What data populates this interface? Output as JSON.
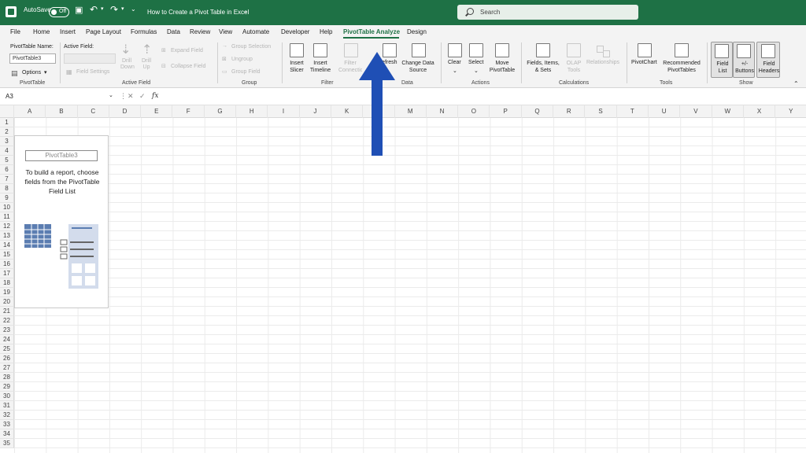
{
  "titlebar": {
    "autosave_label": "AutoSave",
    "autosave_state": "Off",
    "doc_title": "How to Create a Pivot Table in Excel",
    "search_placeholder": "Search"
  },
  "menu": {
    "tabs": [
      "File",
      "Home",
      "Insert",
      "Page Layout",
      "Formulas",
      "Data",
      "Review",
      "View",
      "Automate",
      "Developer",
      "Help",
      "PivotTable Analyze",
      "Design"
    ],
    "active_tab": "PivotTable Analyze"
  },
  "ribbon": {
    "pivottable": {
      "name_label": "PivotTable Name:",
      "name_value": "PivotTable3",
      "options_label": "Options",
      "group_label": "PivotTable"
    },
    "active_field": {
      "label": "Active Field:",
      "field_settings": "Field Settings",
      "drill_down": "Drill Down",
      "drill_up": "Drill Up",
      "expand_field": "Expand Field",
      "collapse_field": "Collapse Field",
      "group_label": "Active Field"
    },
    "group": {
      "group_selection": "Group Selection",
      "ungroup": "Ungroup",
      "group_field": "Group Field",
      "group_label": "Group"
    },
    "filter": {
      "insert_slicer": "Insert Slicer",
      "insert_timeline": "Insert Timeline",
      "filter_connections": "Filter Connections",
      "group_label": "Filter"
    },
    "data": {
      "refresh": "Refresh",
      "change_data_source": "Change Data Source",
      "group_label": "Data"
    },
    "actions": {
      "clear": "Clear",
      "select": "Select",
      "move_pivottable": "Move PivotTable",
      "group_label": "Actions"
    },
    "calculations": {
      "fields_items_sets": "Fields, Items, & Sets",
      "olap_tools": "OLAP Tools",
      "relationships": "Relationships",
      "group_label": "Calculations"
    },
    "tools": {
      "pivotchart": "PivotChart",
      "recommended": "Recommended PivotTables",
      "group_label": "Tools"
    },
    "show": {
      "field_list": "Field List",
      "buttons": "+/- Buttons",
      "field_headers": "Field Headers",
      "group_label": "Show"
    }
  },
  "formula_bar": {
    "name_box": "A3",
    "fx": "fx"
  },
  "sheet": {
    "columns": [
      "A",
      "B",
      "C",
      "D",
      "E",
      "F",
      "G",
      "H",
      "I",
      "J",
      "K",
      "L",
      "M",
      "N",
      "O",
      "P",
      "Q",
      "R",
      "S",
      "T",
      "U",
      "V",
      "W",
      "X",
      "Y"
    ],
    "rows": [
      "1",
      "2",
      "3",
      "4",
      "5",
      "6",
      "7",
      "8",
      "9",
      "10",
      "11",
      "12",
      "13",
      "14",
      "15",
      "16",
      "17",
      "18",
      "19",
      "20",
      "21",
      "22",
      "23",
      "24",
      "25",
      "26",
      "27",
      "28",
      "29",
      "30",
      "31",
      "32",
      "33",
      "34",
      "35"
    ]
  },
  "pivot_placeholder": {
    "name": "PivotTable3",
    "message": "To build a report, choose fields from the PivotTable Field List"
  },
  "colors": {
    "brand": "#1e7145",
    "arrow": "#1f4fb5"
  }
}
